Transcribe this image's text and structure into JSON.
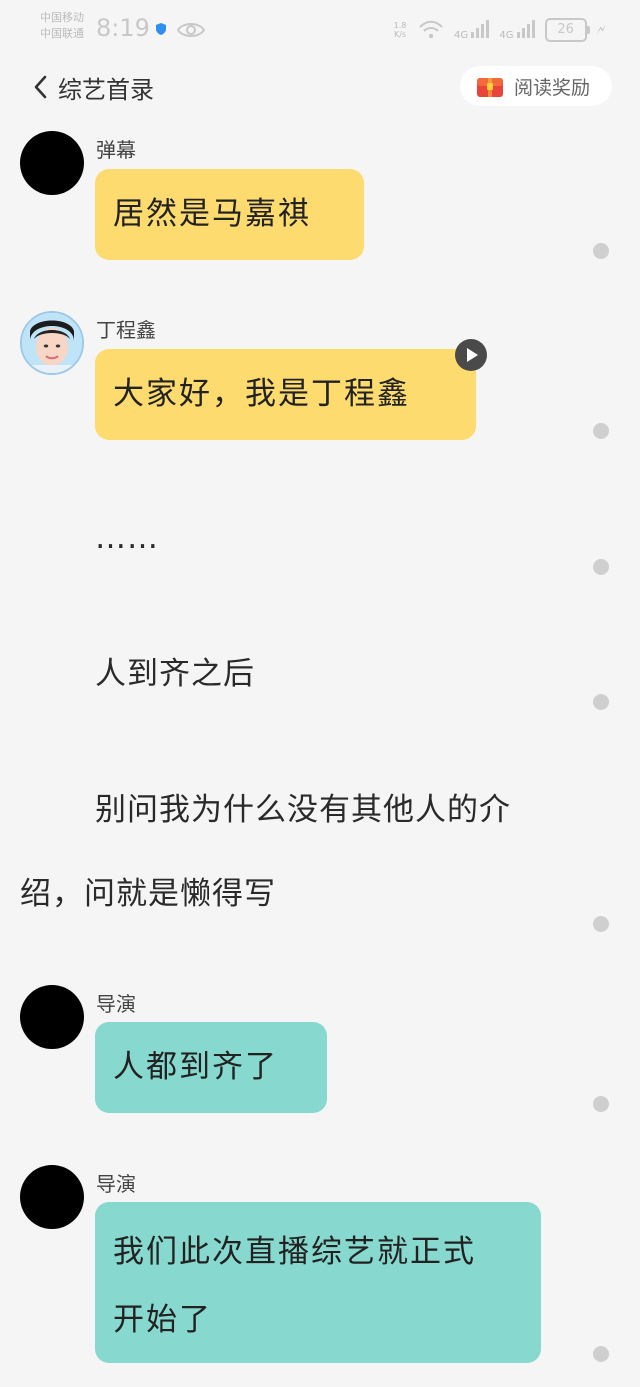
{
  "status_bar": {
    "carrier_1": "中国移动",
    "carrier_2": "中国联通",
    "time": "8:19",
    "net_speed_value": "1.8",
    "net_speed_unit": "K/s",
    "signal_1": "4G",
    "signal_2": "4G",
    "battery": "26"
  },
  "header": {
    "back_label": "综艺首录",
    "reward_label": "阅读奖励"
  },
  "messages": [
    {
      "type": "bubble",
      "sender": "弹幕",
      "text": "居然是马嘉祺",
      "color": "#fedb6f"
    },
    {
      "type": "bubble",
      "sender": "丁程鑫",
      "text": "大家好，我是丁程鑫",
      "color": "#fedb6f",
      "has_voice": true
    },
    {
      "type": "narration",
      "text": "……"
    },
    {
      "type": "narration",
      "text": "人到齐之后"
    },
    {
      "type": "narration",
      "line1": "别问我为什么没有其他人的介",
      "line2": "绍，问就是懒得写"
    },
    {
      "type": "bubble",
      "sender": "导演",
      "text": "人都到齐了",
      "color": "#87d8ce"
    },
    {
      "type": "bubble",
      "sender": "导演",
      "line1": "我们此次直播综艺就正式",
      "line2": "开始了",
      "color": "#87d8ce"
    }
  ],
  "icons": {
    "back": "chevron-left-icon",
    "reward": "gift-box-icon",
    "voice": "play-icon",
    "comment": "comment-dot-icon"
  }
}
